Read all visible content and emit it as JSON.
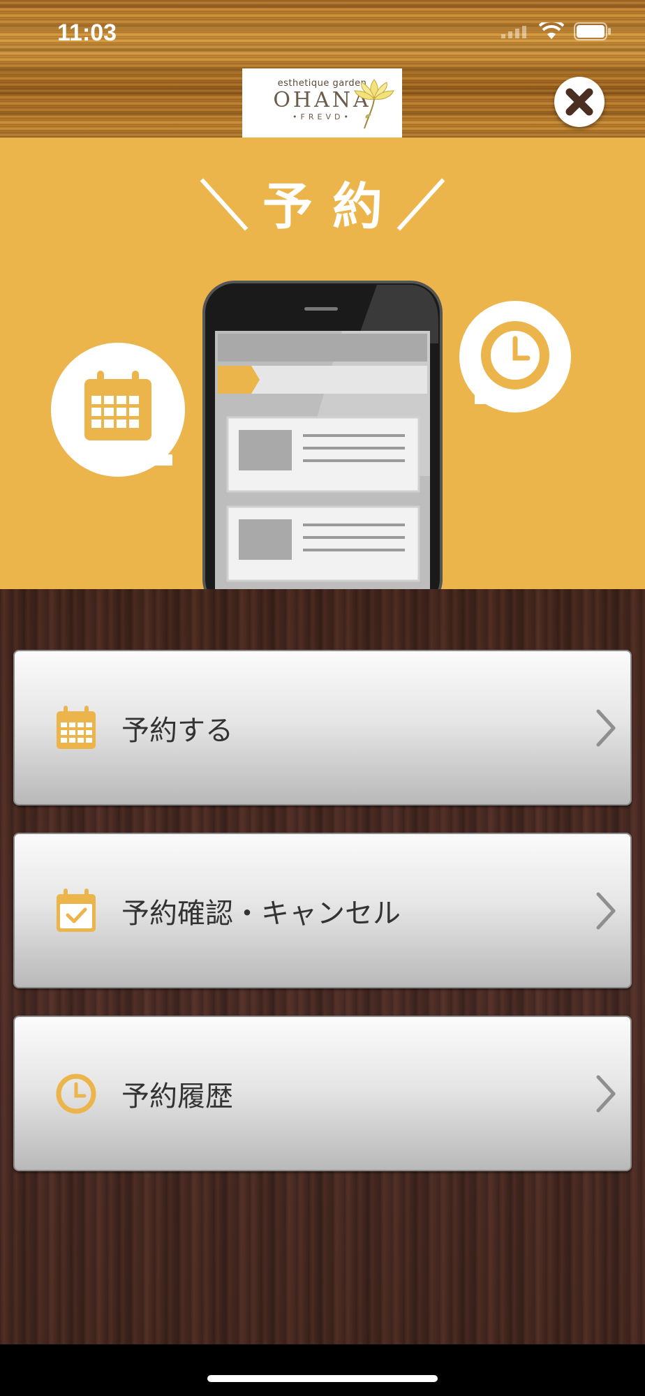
{
  "status_bar": {
    "time": "11:03",
    "icons": [
      "signal-icon",
      "wifi-icon",
      "battery-icon"
    ]
  },
  "header": {
    "logo": {
      "tagline": "esthetique garden",
      "name": "OHANA",
      "sub": "•FREVD•"
    },
    "close_icon": "close-icon"
  },
  "hero": {
    "title": "予約",
    "icons": [
      "calendar-icon",
      "clock-icon",
      "smartphone-illustration"
    ]
  },
  "menu": {
    "items": [
      {
        "label": "予約する",
        "icon": "calendar-icon"
      },
      {
        "label": "予約確認・キャンセル",
        "icon": "calendar-check-icon"
      },
      {
        "label": "予約履歴",
        "icon": "clock-icon"
      }
    ]
  },
  "colors": {
    "accent": "#ecb54b",
    "icon": "#ecb54b",
    "menu_text": "#333333"
  }
}
